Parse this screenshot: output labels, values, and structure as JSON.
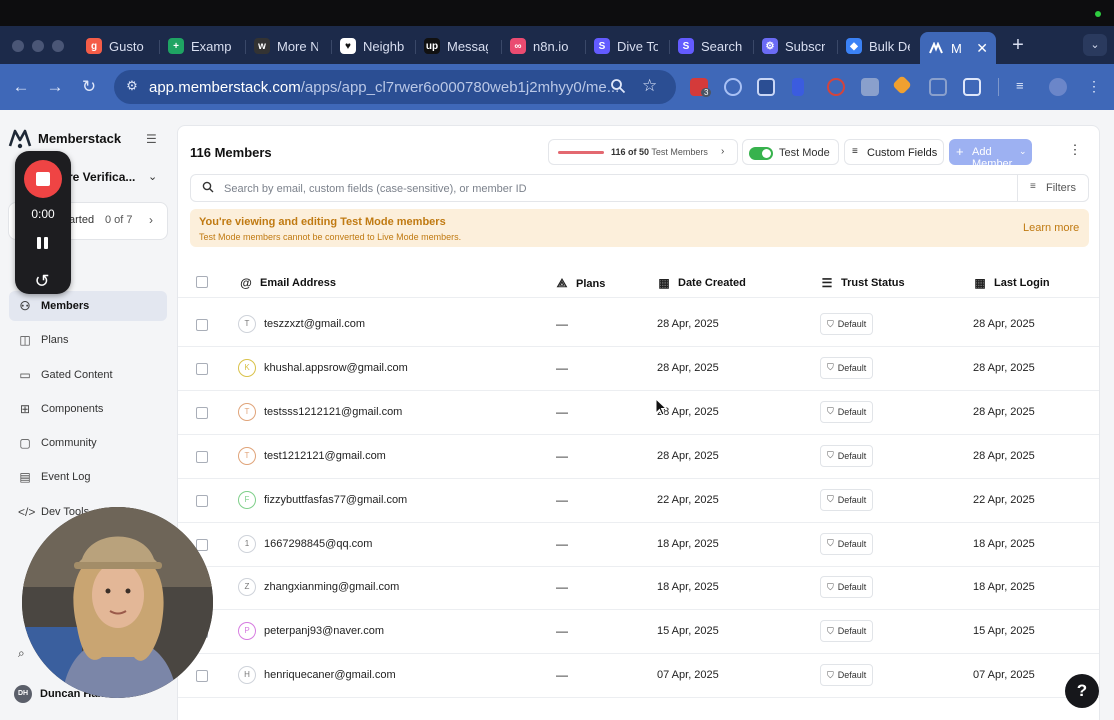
{
  "browser": {
    "tabs": [
      {
        "label": "Gusto",
        "icon": "gusto-icon",
        "color": "#f45d48",
        "glyph": "g"
      },
      {
        "label": "Exampl",
        "icon": "sheets-icon",
        "color": "#1fa463",
        "glyph": "+"
      },
      {
        "label": "More N",
        "icon": "w-icon",
        "color": "#333333",
        "glyph": "w"
      },
      {
        "label": "Neighb",
        "icon": "heart-icon",
        "color": "#ffffff",
        "glyph": "♥"
      },
      {
        "label": "Messag",
        "icon": "upwork-icon",
        "color": "#111111",
        "glyph": "up"
      },
      {
        "label": "n8n.io",
        "icon": "n8n-icon",
        "color": "#ea4b71",
        "glyph": "∞"
      },
      {
        "label": "Dive To",
        "icon": "stripe-icon",
        "color": "#635bff",
        "glyph": "S"
      },
      {
        "label": "Search",
        "icon": "stripe-icon",
        "color": "#635bff",
        "glyph": "S"
      },
      {
        "label": "Subscr",
        "icon": "gear-icon",
        "color": "#6b6bf5",
        "glyph": "⚙"
      },
      {
        "label": "Bulk De",
        "icon": "diamond-icon",
        "color": "#3b82f6",
        "glyph": "◆"
      }
    ],
    "active_tab": {
      "label": "Me",
      "icon": "memberstack-icon"
    },
    "new_tab": "+",
    "tab_menu": "⌄",
    "url_host": "app.memberstack.com",
    "url_path": "/apps/app_cl7rwer6o000780web1j2mhyy0/me...",
    "extension_badge": "3"
  },
  "sidebar": {
    "brand": "Memberstack",
    "site_name": "re Verifica...",
    "get_started": {
      "label": "arted",
      "count": "0 of 7"
    },
    "items": [
      {
        "label": "oard",
        "icon": "dashboard-icon",
        "glyph": "▦",
        "active": false
      },
      {
        "label": "Members",
        "icon": "users-icon",
        "glyph": "⚇",
        "active": true
      },
      {
        "label": "Plans",
        "icon": "plans-icon",
        "glyph": "◫",
        "active": false
      },
      {
        "label": "Gated Content",
        "icon": "folder-icon",
        "glyph": "▭",
        "active": false
      },
      {
        "label": "Components",
        "icon": "grid-icon",
        "glyph": "⊞",
        "active": false
      },
      {
        "label": "Community",
        "icon": "chat-icon",
        "glyph": "▢",
        "active": false
      },
      {
        "label": "Event Log",
        "icon": "inbox-icon",
        "glyph": "▤",
        "active": false
      },
      {
        "label": "Dev Tools",
        "icon": "code-icon",
        "glyph": "</>",
        "active": false
      }
    ],
    "user": {
      "initials": "DH",
      "name": "Duncan Hamra"
    }
  },
  "header": {
    "title": "116 Members",
    "limit": {
      "count": "116 of 50",
      "label": "Test Members",
      "fill_fraction": 1.0
    },
    "test_mode": {
      "label": "Test Mode",
      "on": true
    },
    "custom_fields": "Custom Fields",
    "add_member": "Add Member"
  },
  "search": {
    "placeholder": "Search by email, custom fields (case-sensitive), or member ID",
    "filters": "Filters"
  },
  "banner": {
    "title": "You're viewing and editing Test Mode members",
    "subtitle": "Test Mode members cannot be converted to Live Mode members.",
    "link": "Learn more"
  },
  "table": {
    "columns": [
      {
        "label": "Email Address",
        "icon": "at-icon"
      },
      {
        "label": "Plans",
        "icon": "shapes-icon"
      },
      {
        "label": "Date Created",
        "icon": "calendar-icon"
      },
      {
        "label": "Trust Status",
        "icon": "list-icon"
      },
      {
        "label": "Last Login",
        "icon": "calendar-icon"
      }
    ],
    "rows": [
      {
        "initial": "T",
        "ring": "#cfd3da",
        "email": "teszzxzt@gmail.com",
        "plans": "—",
        "created": "28 Apr, 2025",
        "trust": "Default",
        "login": "28 Apr, 2025"
      },
      {
        "initial": "K",
        "ring": "#d9c24a",
        "email": "khushal.appsrow@gmail.com",
        "plans": "—",
        "created": "28 Apr, 2025",
        "trust": "Default",
        "login": "28 Apr, 2025"
      },
      {
        "initial": "T",
        "ring": "#e0a47a",
        "email": "testsss1212121@gmail.com",
        "plans": "—",
        "created": "28 Apr, 2025",
        "trust": "Default",
        "login": "28 Apr, 2025"
      },
      {
        "initial": "T",
        "ring": "#e0a47a",
        "email": "test1212121@gmail.com",
        "plans": "—",
        "created": "28 Apr, 2025",
        "trust": "Default",
        "login": "28 Apr, 2025"
      },
      {
        "initial": "F",
        "ring": "#7fcf8a",
        "email": "fizzybuttfasfas77@gmail.com",
        "plans": "—",
        "created": "22 Apr, 2025",
        "trust": "Default",
        "login": "22 Apr, 2025"
      },
      {
        "initial": "1",
        "ring": "#cfd3da",
        "email": "1667298845@qq.com",
        "plans": "—",
        "created": "18 Apr, 2025",
        "trust": "Default",
        "login": "18 Apr, 2025"
      },
      {
        "initial": "Z",
        "ring": "#cfd3da",
        "email": "zhangxianming@gmail.com",
        "plans": "—",
        "created": "18 Apr, 2025",
        "trust": "Default",
        "login": "18 Apr, 2025"
      },
      {
        "initial": "P",
        "ring": "#d67be0",
        "email": "peterpanj93@naver.com",
        "plans": "—",
        "created": "15 Apr, 2025",
        "trust": "Default",
        "login": "15 Apr, 2025"
      },
      {
        "initial": "H",
        "ring": "#cfd3da",
        "email": "henriquecaner@gmail.com",
        "plans": "—",
        "created": "07 Apr, 2025",
        "trust": "Default",
        "login": "07 Apr, 2025"
      }
    ]
  },
  "recorder": {
    "time": "0:00"
  },
  "help": "?",
  "colors": {
    "accent": "#3f68b8",
    "add_button": "#9db1f2",
    "toggle_on": "#37b24d",
    "banner_text": "#c07a12",
    "record": "#ef4444"
  }
}
